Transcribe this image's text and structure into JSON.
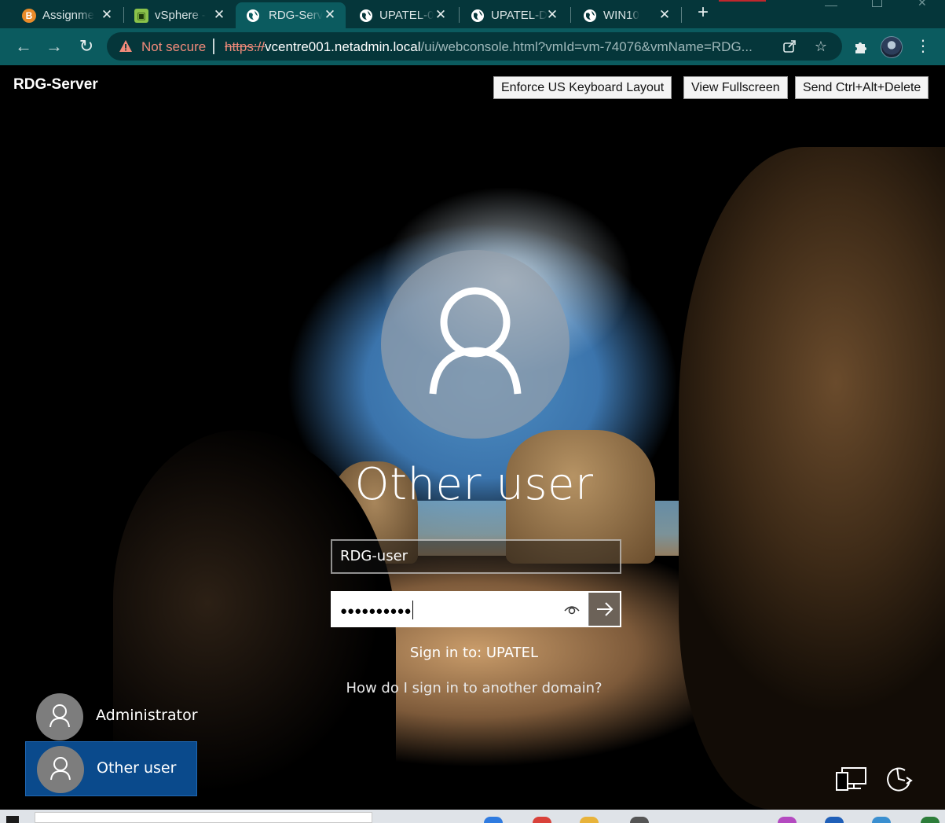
{
  "browser": {
    "tabs": [
      {
        "title": "Assignme",
        "favicon": "b-icon",
        "color": "#e98b2a"
      },
      {
        "title": "vSphere -",
        "favicon": "vsphere-icon",
        "color": "#8bc34a"
      },
      {
        "title": "RDG-Serv",
        "favicon": "globe-icon",
        "color": "#ffffff"
      },
      {
        "title": "UPATEL-0",
        "favicon": "globe-icon",
        "color": "#ffffff"
      },
      {
        "title": "UPATEL-D",
        "favicon": "globe-icon",
        "color": "#ffffff"
      },
      {
        "title": "WIN10",
        "favicon": "globe-icon",
        "color": "#ffffff"
      }
    ],
    "security_label": "Not secure",
    "url_scheme": "https://",
    "url_host": "vcentre001.netadmin.local",
    "url_rest": "/ui/webconsole.html?vmId=vm-74076&vmName=RDG..."
  },
  "console": {
    "vm_name": "RDG-Server",
    "buttons": {
      "keyboard": "Enforce US Keyboard Layout",
      "fullscreen": "View Fullscreen",
      "cad": "Send Ctrl+Alt+Delete"
    }
  },
  "login": {
    "display_name": "Other user",
    "username_value": "RDG-user",
    "password_mask": "●●●●●●●●●●",
    "sign_in_to": "Sign in to: UPATEL",
    "other_domain_link": "How do I sign in to another domain?",
    "accounts": [
      {
        "name": "Administrator"
      },
      {
        "name": "Other user"
      }
    ]
  },
  "colors": {
    "browser_frame": "#05363a",
    "browser_toolbar": "#0b5b5f",
    "selected_account": "#0a4a8c"
  }
}
